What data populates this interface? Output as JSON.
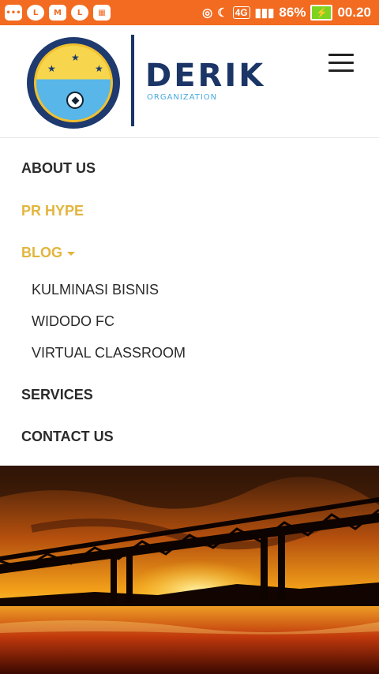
{
  "status_bar": {
    "icons_left": [
      "more-icon",
      "line-icon",
      "gmail-icon",
      "line-icon",
      "app-icon"
    ],
    "network": "4G",
    "battery": "86%",
    "time": "00.20"
  },
  "header": {
    "brand": "DERIK",
    "brand_sub": "ORGANIZATION"
  },
  "nav": {
    "items": [
      {
        "label": "ABOUT US"
      },
      {
        "label": "PR HYPE"
      },
      {
        "label": "BLOG"
      },
      {
        "label": "SERVICES"
      },
      {
        "label": "CONTACT US"
      }
    ],
    "blog_sub": [
      {
        "label": "KULMINASI BISNIS"
      },
      {
        "label": "WIDODO FC"
      },
      {
        "label": "VIRTUAL CLASSROOM"
      }
    ]
  },
  "colors": {
    "status_bar": "#f26b21",
    "accent": "#e2b53d",
    "brand": "#1a3566"
  }
}
